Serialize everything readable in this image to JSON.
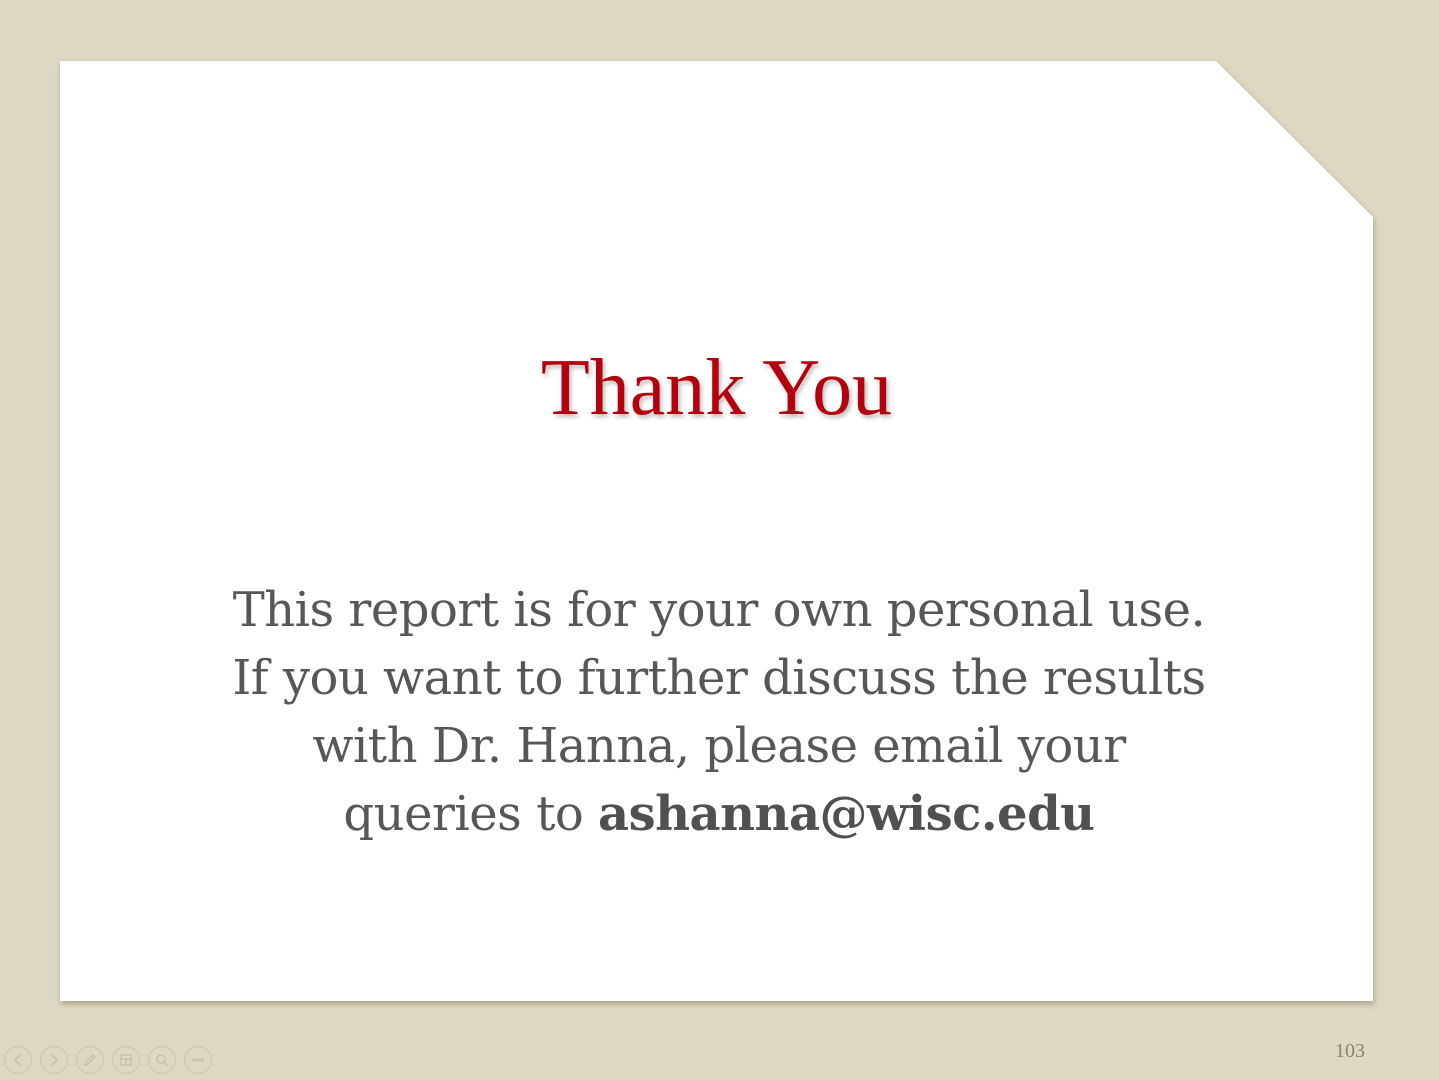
{
  "slide": {
    "title": "Thank You",
    "body_lines": [
      "This report is for your own personal use.",
      "If you want to further discuss the results",
      "with Dr. Hanna, please email your"
    ],
    "body_last_prefix": "queries to ",
    "email": "ashanna@wisc.edu"
  },
  "page_number": "103",
  "controls": [
    {
      "name": "previous-slide",
      "icon": "arrow-left-icon"
    },
    {
      "name": "next-slide",
      "icon": "arrow-right-icon"
    },
    {
      "name": "pen-tool",
      "icon": "pen-icon"
    },
    {
      "name": "see-all-slides",
      "icon": "grid-icon"
    },
    {
      "name": "zoom",
      "icon": "magnifier-icon"
    },
    {
      "name": "more-options",
      "icon": "ellipsis-icon"
    }
  ],
  "colors": {
    "background": "#ddd8c2",
    "title": "#b3000c",
    "body_text": "#575757"
  }
}
